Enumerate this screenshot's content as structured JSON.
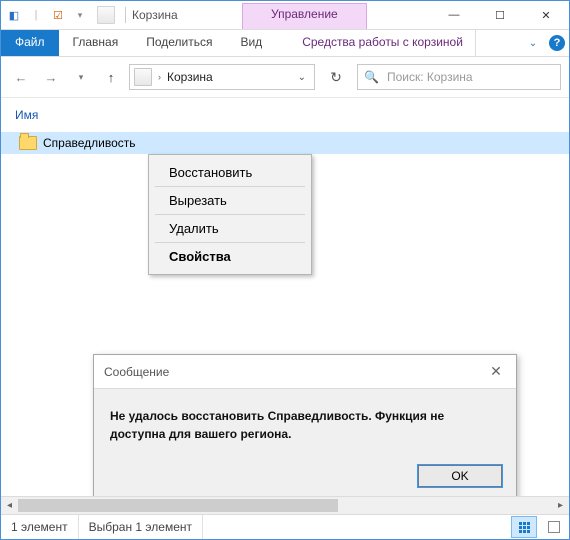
{
  "titlebar": {
    "title": "Корзина",
    "context_tab": "Управление"
  },
  "ribbon": {
    "file": "Файл",
    "tabs": [
      "Главная",
      "Поделиться",
      "Вид"
    ],
    "context_label": "Средства работы с корзиной"
  },
  "nav": {
    "breadcrumb": "Корзина"
  },
  "search": {
    "placeholder": "Поиск: Корзина"
  },
  "columns": {
    "name": "Имя"
  },
  "files": [
    {
      "name": "Справедливость"
    }
  ],
  "context_menu": {
    "items": [
      "Восстановить",
      "Вырезать",
      "Удалить",
      "Свойства"
    ]
  },
  "dialog": {
    "title": "Сообщение",
    "body": "Не удалось восстановить Справедливость. Функция не доступна для вашего региона.",
    "ok": "OK"
  },
  "status": {
    "count": "1 элемент",
    "selection": "Выбран 1 элемент"
  }
}
